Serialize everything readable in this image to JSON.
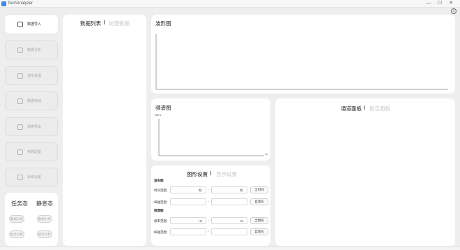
{
  "window": {
    "title": "TechAnalyzer",
    "minimize": "—",
    "maximize": "☐",
    "close": "✕",
    "info_icon": "i"
  },
  "sidebar": {
    "items": [
      {
        "label": "数据导入",
        "icon": "import-icon",
        "active": true
      },
      {
        "label": "数据分析",
        "icon": "analysis-icon",
        "active": false
      },
      {
        "label": "波形处理",
        "icon": "waveform-icon",
        "active": false
      },
      {
        "label": "数据存储",
        "icon": "storage-icon",
        "active": false
      },
      {
        "label": "报表导出",
        "icon": "export-icon",
        "active": false
      },
      {
        "label": "参数配置",
        "icon": "config-icon",
        "active": false
      },
      {
        "label": "系统设置",
        "icon": "settings-icon",
        "active": false
      }
    ]
  },
  "status": {
    "task_state": "任务态",
    "static_state": "静息态",
    "task_buttons": [
      "数据分析",
      "统计分析"
    ],
    "static_buttons": [
      "数据分析",
      "统计分析"
    ]
  },
  "data_list": {
    "title": "数据列表",
    "tab2": "处理数据"
  },
  "waveform": {
    "title": "波形图"
  },
  "spectrum": {
    "title": "频谱图",
    "y_unit": "dB/Hz",
    "x_unit": "Hz"
  },
  "channel": {
    "title": "通道面板",
    "tab2": "报告面板"
  },
  "settings": {
    "title": "图形设置",
    "tab2": "显示设置",
    "waveform_section": "波形图",
    "spectrum_section": "频谱图",
    "rows": [
      {
        "label": "时间范围:",
        "unit": "帧",
        "button": "全时间"
      },
      {
        "label": "纵轴范围:",
        "unit": "",
        "button": "自适应"
      },
      {
        "label": "频率范围:",
        "unit": "Hz",
        "button": "全频段"
      },
      {
        "label": "纵轴范围:",
        "unit": "",
        "button": "自适应"
      }
    ],
    "dash": "-"
  }
}
